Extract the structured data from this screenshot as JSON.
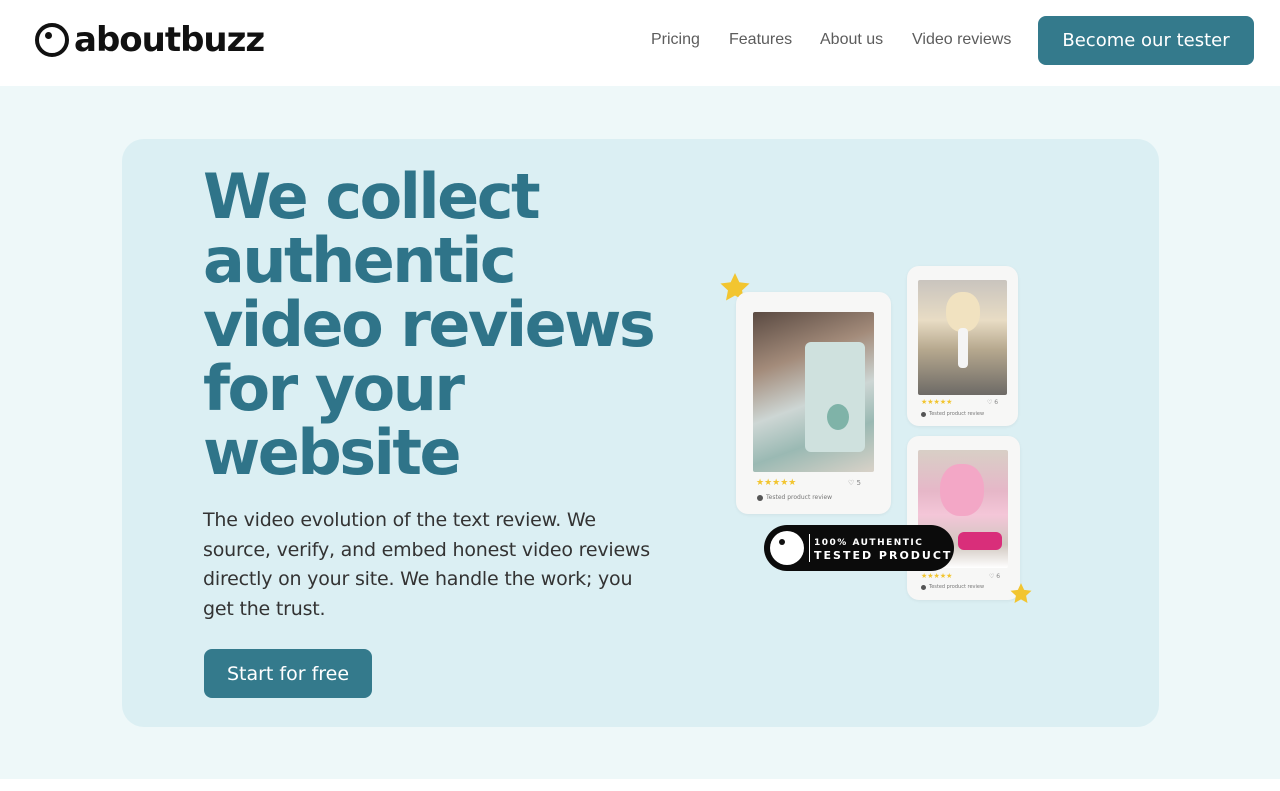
{
  "header": {
    "logo_text": "aboutbuzz",
    "nav": [
      "Pricing",
      "Features",
      "About us",
      "Video reviews"
    ],
    "cta_label": "Become our tester"
  },
  "hero": {
    "headline_lines": [
      "We collect",
      "authentic",
      "video reviews",
      "for your",
      "website"
    ],
    "subtext": "The video evolution of the text review. We source, verify, and embed honest video reviews directly on your site. We handle the work; you get the trust.",
    "cta_label": "Start for free"
  },
  "review_cards": [
    {
      "rating": 5,
      "likes": "5",
      "tag": "Tested product review"
    },
    {
      "rating": 5,
      "likes": "6",
      "tag": "Tested product review"
    },
    {
      "rating": 5,
      "likes": "6",
      "tag": "Tested product review"
    }
  ],
  "badge": {
    "line1": "100% AUTHENTIC",
    "line2": "TESTED PRODUCT"
  },
  "colors": {
    "brand": "#347a8c",
    "headline": "#2f7489",
    "hero_bg": "#dbeff3",
    "band_bg": "#eef8f9",
    "star": "#f2c530"
  },
  "icons": [
    "logo-mark-icon",
    "star-icon",
    "heart-icon",
    "check-dot-icon"
  ]
}
